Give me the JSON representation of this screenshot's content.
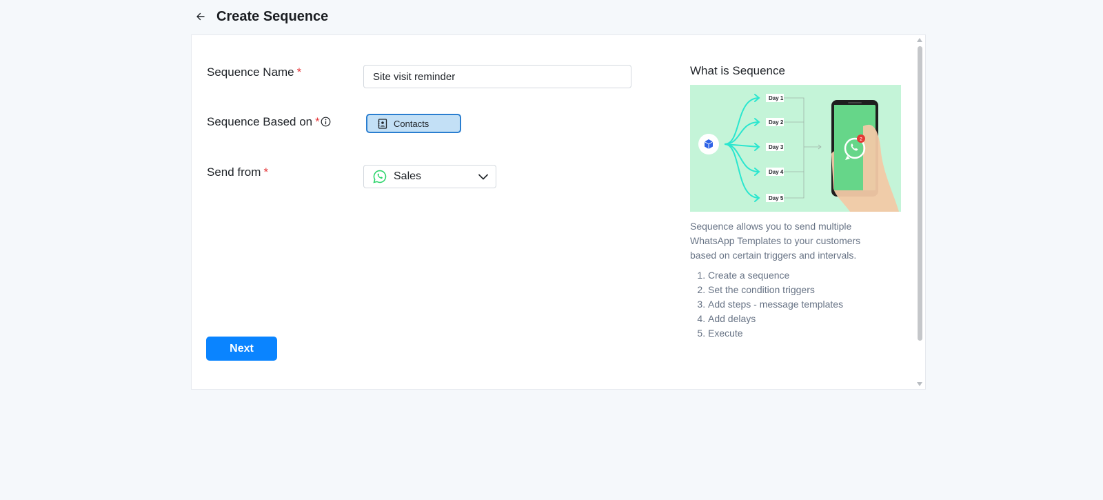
{
  "header": {
    "title": "Create Sequence"
  },
  "form": {
    "name_label": "Sequence Name",
    "name_value": "Site visit reminder",
    "based_on_label": "Sequence Based on",
    "based_on_option": "Contacts",
    "send_from_label": "Send from",
    "send_from_value": "Sales",
    "required_mark": "*",
    "next_label": "Next"
  },
  "sidebar": {
    "title": "What is Sequence",
    "illustration": {
      "days": [
        "Day 1",
        "Day 2",
        "Day 3",
        "Day 4",
        "Day 5"
      ],
      "badge": "2"
    },
    "description": "Sequence allows you to send multiple WhatsApp Templates to your customers based on certain triggers and intervals.",
    "steps": [
      "Create a sequence",
      "Set the condition triggers",
      "Add steps - message templates",
      "Add delays",
      "Execute"
    ]
  },
  "colors": {
    "primary": "#0a84ff",
    "chip_bg": "#c3e0f6",
    "chip_border": "#2a7ed0",
    "required": "#e5373a",
    "whatsapp": "#25d366",
    "illustration_bg": "#c4f4d8"
  }
}
